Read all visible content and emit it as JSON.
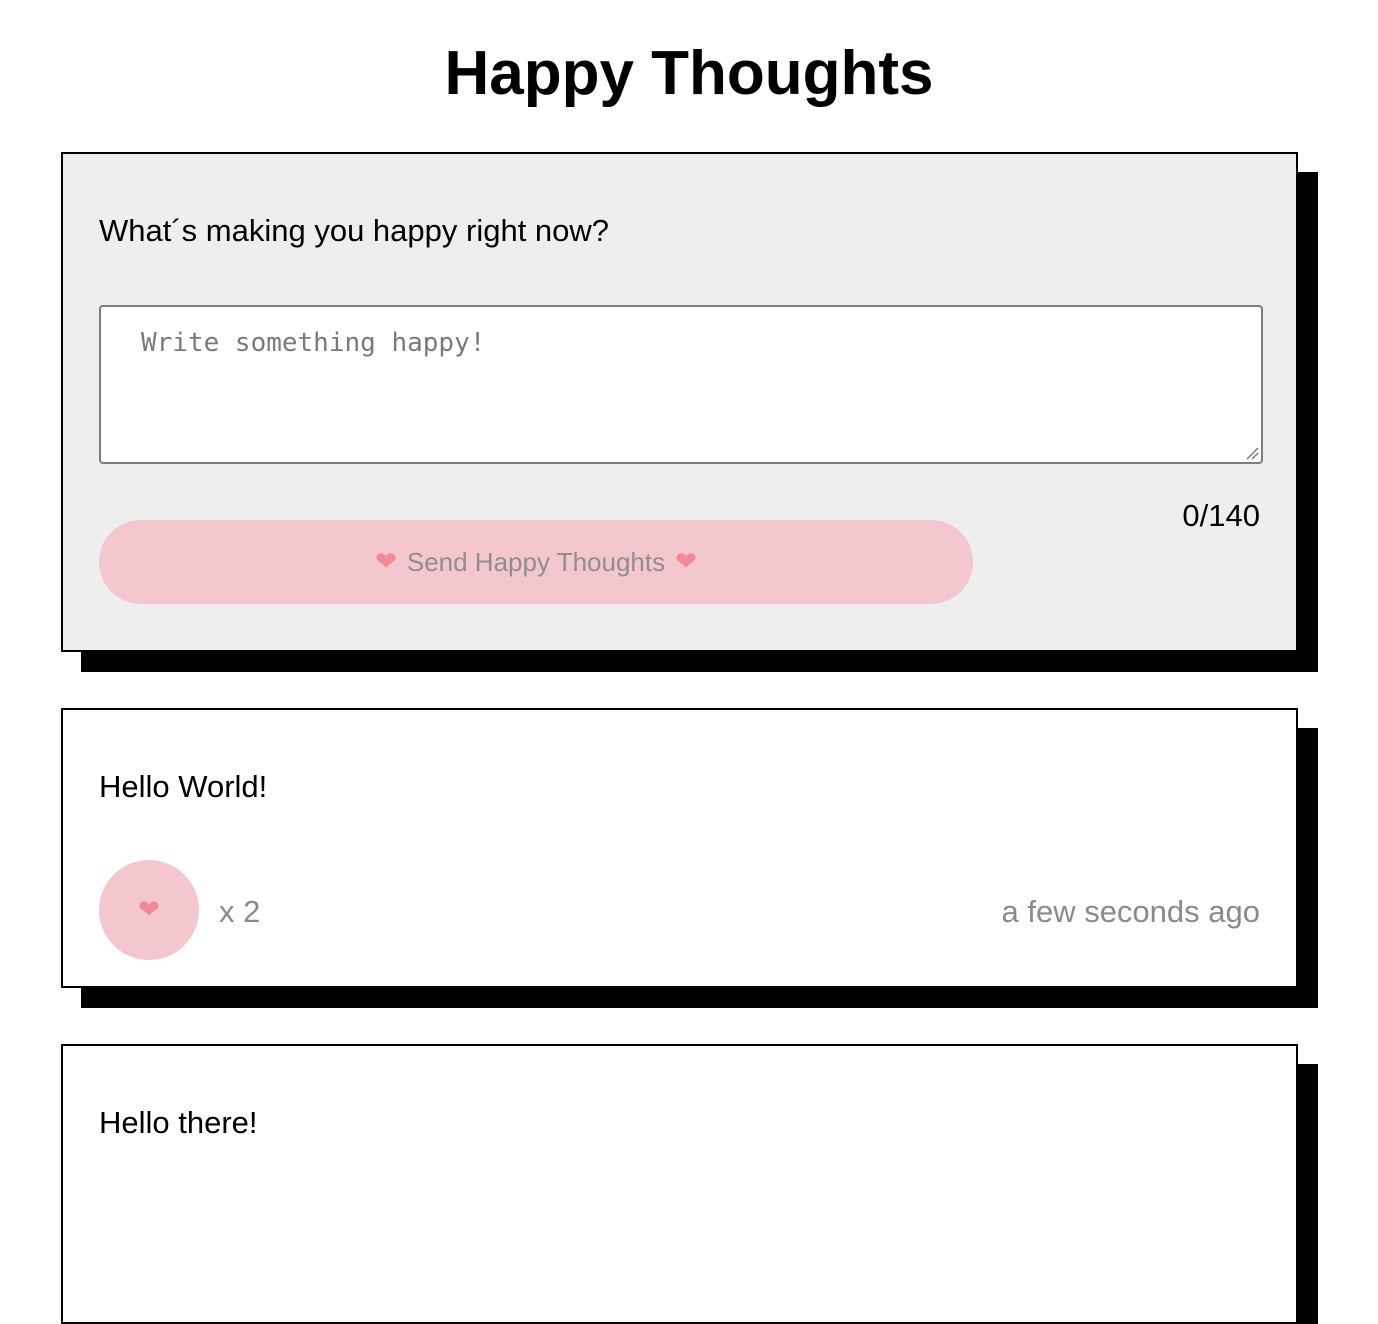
{
  "header": {
    "title": "Happy Thoughts"
  },
  "form": {
    "question": "What´s making you happy right now?",
    "placeholder": "Write something happy!",
    "value": "",
    "char_count": "0/140",
    "send_label": "Send Happy Thoughts",
    "send_disabled": true,
    "heart_icon": "heart-icon"
  },
  "thoughts": [
    {
      "message": "Hello World!",
      "likes": "x 2",
      "time": "a few seconds ago"
    },
    {
      "message": "Hello there!"
    }
  ],
  "colors": {
    "form_background": "#eeeeee",
    "button_pink": "#f4c6cd",
    "heart": "#f08a94",
    "muted_text": "#8a8a8a",
    "shadow": "#000000"
  }
}
